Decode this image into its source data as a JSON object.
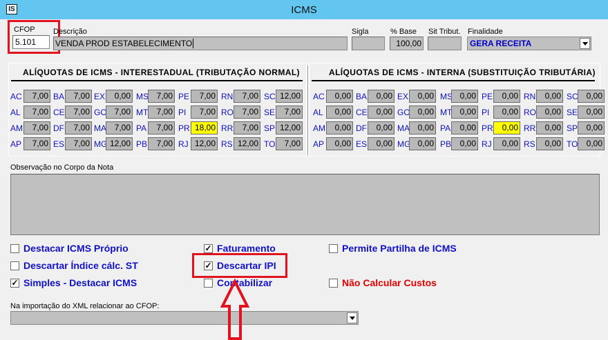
{
  "window": {
    "title": "ICMS",
    "app_icon": "app-icon"
  },
  "cfop": {
    "label": "CFOP",
    "value": "5.101"
  },
  "descricao": {
    "label": "Descrição",
    "value": "VENDA PROD ESTABELECIMENTO"
  },
  "sigla": {
    "label": "Sigla",
    "value": ""
  },
  "base": {
    "label": "% Base",
    "value": "100,00"
  },
  "sit_tribut": {
    "label": "Sit Tribut.",
    "value": ""
  },
  "finalidade": {
    "label": "Finalidade",
    "value": "GERA RECEITA"
  },
  "interestadual": {
    "title": "ALÍQUOTAS DE ICMS - INTERESTADUAL (TRIBUTAÇÃO NORMAL)",
    "rows": [
      [
        {
          "uf": "AC",
          "v": "7,00"
        },
        {
          "uf": "BA",
          "v": "7,00"
        },
        {
          "uf": "EX",
          "v": "0,00"
        },
        {
          "uf": "MS",
          "v": "7,00"
        },
        {
          "uf": "PE",
          "v": "7,00"
        },
        {
          "uf": "RN",
          "v": "7,00"
        },
        {
          "uf": "SC",
          "v": "12,00"
        }
      ],
      [
        {
          "uf": "AL",
          "v": "7,00"
        },
        {
          "uf": "CE",
          "v": "7,00"
        },
        {
          "uf": "GO",
          "v": "7,00"
        },
        {
          "uf": "MT",
          "v": "7,00"
        },
        {
          "uf": "PI",
          "v": "7,00"
        },
        {
          "uf": "RO",
          "v": "7,00"
        },
        {
          "uf": "SE",
          "v": "7,00"
        }
      ],
      [
        {
          "uf": "AM",
          "v": "7,00"
        },
        {
          "uf": "DF",
          "v": "7,00"
        },
        {
          "uf": "MA",
          "v": "7,00"
        },
        {
          "uf": "PA",
          "v": "7,00"
        },
        {
          "uf": "PR",
          "v": "18,00",
          "hl": true
        },
        {
          "uf": "RR",
          "v": "7,00"
        },
        {
          "uf": "SP",
          "v": "12,00"
        }
      ],
      [
        {
          "uf": "AP",
          "v": "7,00"
        },
        {
          "uf": "ES",
          "v": "7,00"
        },
        {
          "uf": "MG",
          "v": "12,00"
        },
        {
          "uf": "PB",
          "v": "7,00"
        },
        {
          "uf": "RJ",
          "v": "12,00"
        },
        {
          "uf": "RS",
          "v": "12,00"
        },
        {
          "uf": "TO",
          "v": "7,00"
        }
      ]
    ]
  },
  "interna": {
    "title": "ALÍQUOTAS DE ICMS - INTERNA (SUBSTITUIÇÃO TRIBUTÁRIA)",
    "rows": [
      [
        {
          "uf": "AC",
          "v": "0,00"
        },
        {
          "uf": "BA",
          "v": "0,00"
        },
        {
          "uf": "EX",
          "v": "0,00"
        },
        {
          "uf": "MS",
          "v": "0,00"
        },
        {
          "uf": "PE",
          "v": "0,00"
        },
        {
          "uf": "RN",
          "v": "0,00"
        },
        {
          "uf": "SC",
          "v": "0,00"
        }
      ],
      [
        {
          "uf": "AL",
          "v": "0,00"
        },
        {
          "uf": "CE",
          "v": "0,00"
        },
        {
          "uf": "GO",
          "v": "0,00"
        },
        {
          "uf": "MT",
          "v": "0,00"
        },
        {
          "uf": "PI",
          "v": "0,00"
        },
        {
          "uf": "RO",
          "v": "0,00"
        },
        {
          "uf": "SE",
          "v": "0,00"
        }
      ],
      [
        {
          "uf": "AM",
          "v": "0,00"
        },
        {
          "uf": "DF",
          "v": "0,00"
        },
        {
          "uf": "MA",
          "v": "0,00"
        },
        {
          "uf": "PA",
          "v": "0,00"
        },
        {
          "uf": "PR",
          "v": "0,00",
          "hl": true
        },
        {
          "uf": "RR",
          "v": "0,00"
        },
        {
          "uf": "SP",
          "v": "0,00"
        }
      ],
      [
        {
          "uf": "AP",
          "v": "0,00"
        },
        {
          "uf": "ES",
          "v": "0,00"
        },
        {
          "uf": "MG",
          "v": "0,00"
        },
        {
          "uf": "PB",
          "v": "0,00"
        },
        {
          "uf": "RJ",
          "v": "0,00"
        },
        {
          "uf": "RS",
          "v": "0,00"
        },
        {
          "uf": "TO",
          "v": "0,00"
        }
      ]
    ]
  },
  "observacao": {
    "label": "Observação no Corpo da Nota",
    "value": ""
  },
  "checkboxes": {
    "destacar_icms": {
      "label": "Destacar ICMS Próprio",
      "checked": false
    },
    "descartar_indice": {
      "label": "Descartar Índice cálc. ST",
      "checked": false
    },
    "simples": {
      "label": "Simples - Destacar ICMS",
      "checked": true
    },
    "faturamento": {
      "label": "Faturamento",
      "checked": true
    },
    "descartar_ipi": {
      "label": "Descartar IPI",
      "checked": true
    },
    "contabilizar": {
      "label": "Contabilizar",
      "checked": false
    },
    "partilha": {
      "label": "Permite Partilha de ICMS",
      "checked": false
    },
    "nao_calcular": {
      "label": "Não Calcular Custos",
      "checked": false
    }
  },
  "importacao": {
    "label": "Na importação do XML relacionar ao CFOP:",
    "value": ""
  },
  "colors": {
    "highlight": "#e0131e",
    "link_blue": "#1010c8",
    "rate_highlight": "#ffff00",
    "titlebar": "#62c6f0"
  }
}
